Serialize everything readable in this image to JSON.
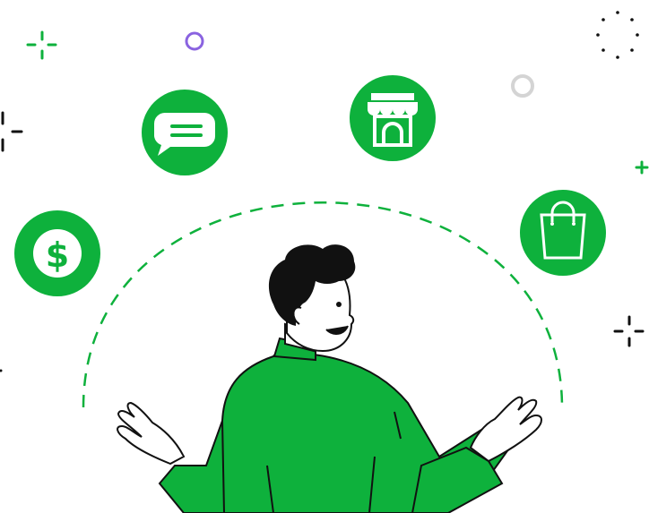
{
  "illustration": {
    "colors": {
      "brand_green": "#0eb13c",
      "ink": "#111111",
      "decor_gray": "#d4d4d4",
      "decor_purple": "#8a63e0"
    },
    "icons": [
      {
        "name": "dollar-icon",
        "glyph": "$"
      },
      {
        "name": "chat-icon"
      },
      {
        "name": "store-icon"
      },
      {
        "name": "shopping-bag-icon"
      }
    ]
  }
}
